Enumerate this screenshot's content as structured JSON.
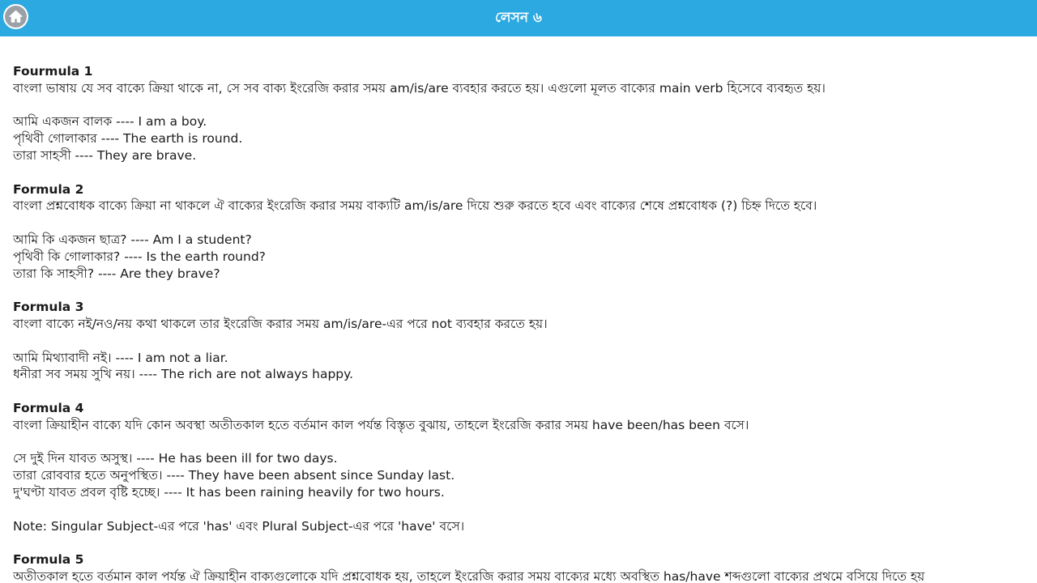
{
  "header": {
    "title": "লেসন ৬",
    "home_icon": "home-icon",
    "bar_color": "#2ca9e1"
  },
  "formulas": [
    {
      "heading": "Fourmula 1",
      "rule": "বাংলা ভাষায় যে সব বাক্যে ক্রিয়া থাকে না, সে সব বাক্য ইংরেজি করার সময় am/is/are ব্যবহার করতে হয়। এগুলো মূলত বাক্যের main verb হিসেবে ব্যবহৃত হয়।",
      "examples": [
        "আমি একজন বালক ---- I am a boy.",
        "পৃথিবী গোলাকার ---- The earth is round.",
        "তারা সাহসী ---- They are brave."
      ]
    },
    {
      "heading": "Formula 2",
      "rule": "বাংলা প্রশ্নবোধক বাক্যে ক্রিয়া না থাকলে ঐ বাক্যের ইংরেজি করার সময় বাক্যটি am/is/are দিয়ে শুরু করতে হবে এবং বাক্যের শেষে প্রশ্নবোধক (?) চিহ্ন দিতে হবে।",
      "examples": [
        "আমি কি একজন ছাত্র? ---- Am I a student?",
        "পৃথিবী কি গোলাকার? ---- Is the earth round?",
        "তারা কি সাহসী? ---- Are they brave?"
      ]
    },
    {
      "heading": "Formula 3",
      "rule": "বাংলা বাক্যে নই/নও/নয় কথা থাকলে তার ইংরেজি করার সময় am/is/are-এর পরে not ব্যবহার করতে হয়।",
      "examples": [
        "আমি মিথ্যাবাদী নই। ---- I am not a liar.",
        "ধনীরা সব সময় সুখি নয়। ---- The rich are not always happy."
      ]
    },
    {
      "heading": "Formula 4",
      "rule": "বাংলা ক্রিয়াহীন বাক্যে যদি কোন অবস্থা অতীতকাল হতে বর্তমান কাল পর্যন্ত বিস্তৃত বুঝায়, তাহলে ইংরেজি করার সময় have been/has been বসে।",
      "examples": [
        "সে দুই দিন যাবত অসুস্থ। ---- He has been ill for two days.",
        "তারা রোববার হতে অনুপস্থিত। ---- They have been absent since Sunday last.",
        "দু'ঘণ্টা যাবত প্রবল বৃষ্টি হচ্ছে। ---- It has been raining heavily for two hours."
      ],
      "note": "Note: Singular Subject-এর পরে 'has' এবং Plural Subject-এর পরে 'have' বসে।"
    },
    {
      "heading": "Formula 5",
      "rule": "অতীতকাল হতে বর্তমান কাল পর্যন্ত ঐ ক্রিয়াহীন বাক্যগুলোকে যদি প্রশ্নবোধক হয়, তাহলে ইংরেজি করার সময় বাক্যের মধ্যে অবস্থিত has/have শব্দগুলো বাক্যের প্রথমে বসিয়ে দিতে হয়"
    }
  ]
}
